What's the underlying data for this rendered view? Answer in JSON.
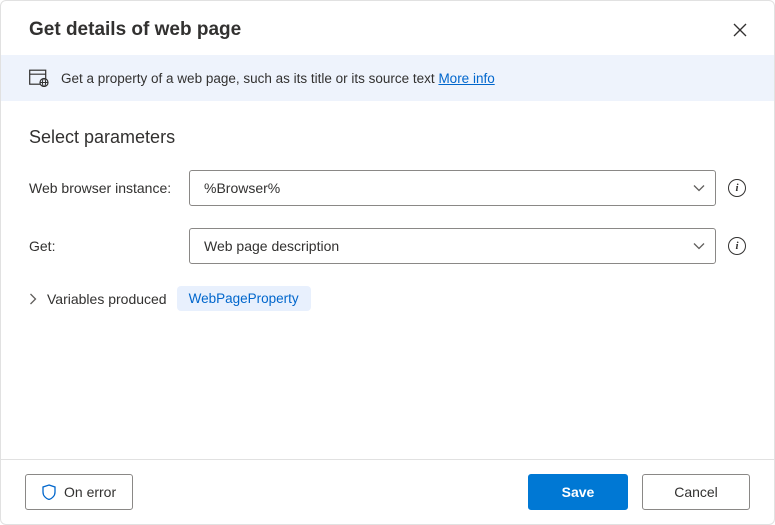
{
  "dialog": {
    "title": "Get details of web page"
  },
  "banner": {
    "text": "Get a property of a web page, such as its title or its source text ",
    "link": "More info"
  },
  "section": {
    "title": "Select parameters"
  },
  "fields": {
    "browser": {
      "label": "Web browser instance:",
      "value": "%Browser%"
    },
    "get": {
      "label": "Get:",
      "value": "Web page description"
    }
  },
  "variables": {
    "label": "Variables produced",
    "pill": "WebPageProperty"
  },
  "footer": {
    "error": "On error",
    "save": "Save",
    "cancel": "Cancel"
  },
  "help": {
    "char": "i"
  }
}
